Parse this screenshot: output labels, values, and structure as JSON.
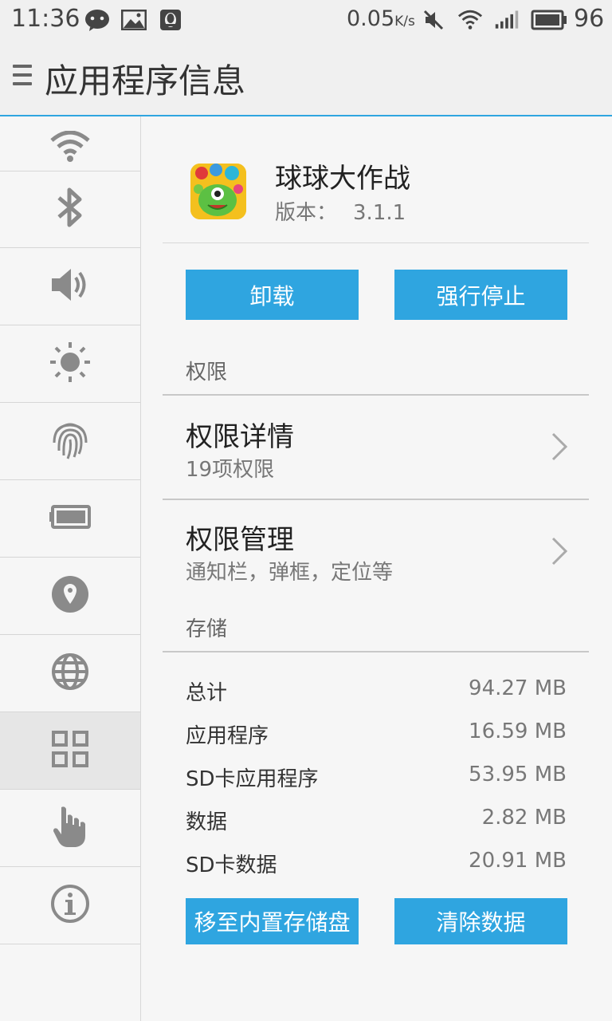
{
  "status_bar": {
    "time": "11:36",
    "net_speed": "0.05",
    "net_speed_unit": "K/s",
    "battery_level": "96",
    "icons": [
      "wechat-icon",
      "image-icon",
      "qq-icon",
      "mute-icon",
      "wifi-icon",
      "signal-icon",
      "battery-icon"
    ]
  },
  "header": {
    "title": "应用程序信息"
  },
  "sidebar": {
    "items": [
      {
        "icon": "wifi-icon"
      },
      {
        "icon": "bluetooth-icon"
      },
      {
        "icon": "volume-icon"
      },
      {
        "icon": "brightness-icon"
      },
      {
        "icon": "fingerprint-icon"
      },
      {
        "icon": "battery-icon"
      },
      {
        "icon": "location-icon"
      },
      {
        "icon": "globe-icon"
      },
      {
        "icon": "apps-grid-icon",
        "active": true
      },
      {
        "icon": "hand-gesture-icon"
      },
      {
        "icon": "info-icon"
      }
    ]
  },
  "app": {
    "name": "球球大作战",
    "version_label": "版本：",
    "version": "3.1.1"
  },
  "buttons": {
    "uninstall": "卸载",
    "force_stop": "强行停止",
    "move_storage": "移至内置存储盘",
    "clear_data": "清除数据"
  },
  "permissions": {
    "section_label": "权限",
    "details_title": "权限详情",
    "details_sub": "19项权限",
    "manage_title": "权限管理",
    "manage_sub": "通知栏，弹框，定位等"
  },
  "storage": {
    "section_label": "存储",
    "rows": [
      {
        "label": "总计",
        "value": "94.27 MB"
      },
      {
        "label": "应用程序",
        "value": "16.59 MB"
      },
      {
        "label": "SD卡应用程序",
        "value": "53.95 MB"
      },
      {
        "label": "数据",
        "value": "2.82 MB"
      },
      {
        "label": "SD卡数据",
        "value": "20.91 MB"
      }
    ]
  },
  "colors": {
    "accent": "#2fa5e0",
    "icon_gray": "#8a8a8a"
  }
}
